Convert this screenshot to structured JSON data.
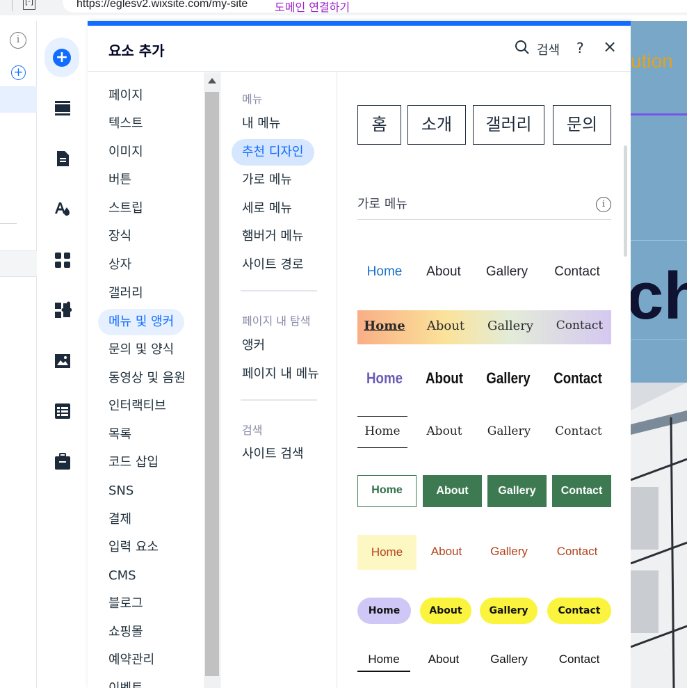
{
  "browser": {
    "url": "https://eglesv2.wixsite.com/my-site",
    "url_hint": "도메인 연결하기",
    "frag_left": "ˇ",
    "ext_icon": "[·]"
  },
  "farleft": {
    "info_icon": "i",
    "plus_icon": "+"
  },
  "rail": {
    "add_icon": "+",
    "icons": [
      "sections-icon",
      "page-icon",
      "theme-icon",
      "apps-icon",
      "puzzle-icon",
      "media-icon",
      "cms-table-icon",
      "business-icon"
    ]
  },
  "panel": {
    "title": "요소 추가",
    "search_label": "검색",
    "help": "?",
    "close": "×",
    "accent": "#116dff"
  },
  "categories": [
    "페이지",
    "텍스트",
    "이미지",
    "버튼",
    "스트립",
    "장식",
    "상자",
    "갤러리",
    "메뉴 및 앵커",
    "문의 및 양식",
    "동영상 및 음원",
    "인터랙티브",
    "목록",
    "코드 삽입",
    "SNS",
    "결제",
    "입력 요소",
    "CMS",
    "블로그",
    "쇼핑몰",
    "예약관리",
    "이벤트"
  ],
  "subs": {
    "group1_head": "메뉴",
    "group1": [
      "내 메뉴",
      "추천 디자인",
      "가로 메뉴",
      "세로 메뉴",
      "햄버거 메뉴",
      "사이트 경로"
    ],
    "group2_head": "페이지 내 탐색",
    "group2": [
      "앵커",
      "페이지 내 메뉴"
    ],
    "group3_head": "검색",
    "group3": [
      "사이트 검색"
    ]
  },
  "content": {
    "ko_menu": [
      "홈",
      "소개",
      "갤러리",
      "문의"
    ],
    "section_title": "가로 메뉴",
    "info": "i",
    "menu_items": [
      "Home",
      "About",
      "Gallery",
      "Contact"
    ]
  },
  "site": {
    "heading_fragment": "ution",
    "hero_fragment": "ch"
  }
}
